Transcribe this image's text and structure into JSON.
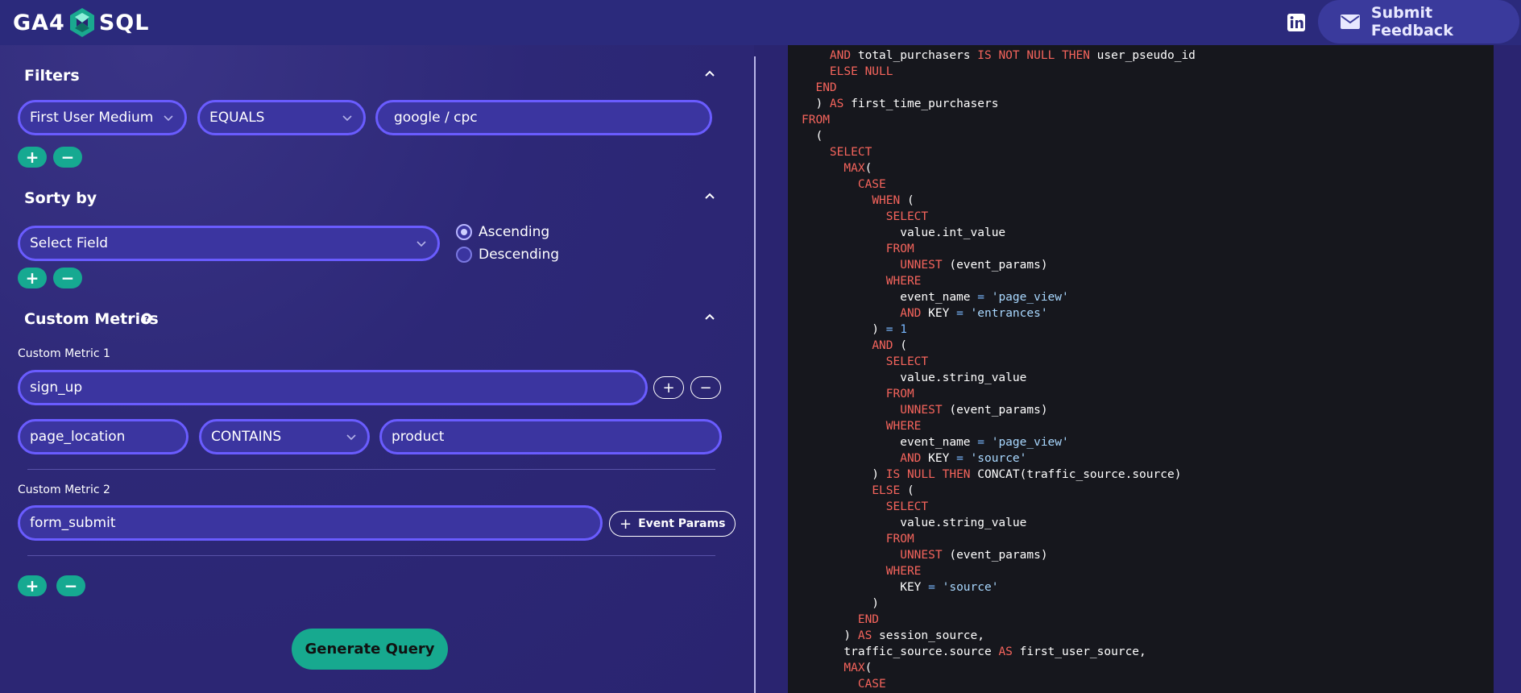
{
  "header": {
    "logo_left": "GA4",
    "logo_right": "SQL",
    "feedback_label": "Submit Feedback"
  },
  "filters": {
    "title": "Filters",
    "field": "First User Medium",
    "operator": "EQUALS",
    "value": "google / cpc",
    "add_label": "+",
    "remove_label": "−"
  },
  "sort": {
    "title": "Sorty by",
    "field_placeholder": "Select Field",
    "options": [
      "Ascending",
      "Descending"
    ],
    "selected": "Ascending",
    "add_label": "+",
    "remove_label": "−"
  },
  "custom_metrics": {
    "title": "Custom Metrics",
    "metric1": {
      "label": "Custom Metric 1",
      "event": "sign_up",
      "param": "page_location",
      "operator": "CONTAINS",
      "value": "product",
      "add_label": "+",
      "remove_label": "−"
    },
    "metric2": {
      "label": "Custom Metric 2",
      "event": "form_submit",
      "event_params_label": "Event Params"
    },
    "add_label": "+",
    "remove_label": "−"
  },
  "generate_label": "Generate Query",
  "sql_lines": [
    [
      [
        "    "
      ],
      [
        "AND",
        "kw"
      ],
      [
        " total_purchasers "
      ],
      [
        "IS NOT NULL THEN",
        "kw"
      ],
      [
        " user_pseudo_id"
      ]
    ],
    [
      [
        "    "
      ],
      [
        "ELSE NULL",
        "kw"
      ]
    ],
    [
      [
        "  "
      ],
      [
        "END",
        "kw"
      ]
    ],
    [
      [
        "  ) "
      ],
      [
        "AS",
        "kw"
      ],
      [
        " first_time_purchasers"
      ]
    ],
    [
      [
        "FROM",
        "kw"
      ]
    ],
    [
      [
        "  ("
      ]
    ],
    [
      [
        "    "
      ],
      [
        "SELECT",
        "kw"
      ]
    ],
    [
      [
        "      "
      ],
      [
        "MAX",
        "kw"
      ],
      [
        "("
      ]
    ],
    [
      [
        "        "
      ],
      [
        "CASE",
        "kw"
      ]
    ],
    [
      [
        "          "
      ],
      [
        "WHEN",
        "kw"
      ],
      [
        " ("
      ]
    ],
    [
      [
        "            "
      ],
      [
        "SELECT",
        "kw"
      ]
    ],
    [
      [
        "              value.int_value"
      ]
    ],
    [
      [
        "            "
      ],
      [
        "FROM",
        "kw"
      ]
    ],
    [
      [
        "              "
      ],
      [
        "UNNEST",
        "kw"
      ],
      [
        " (event_params)"
      ]
    ],
    [
      [
        "            "
      ],
      [
        "WHERE",
        "kw"
      ]
    ],
    [
      [
        "              event_name "
      ],
      [
        "=",
        "num"
      ],
      [
        " "
      ],
      [
        "'page_view'",
        "str"
      ]
    ],
    [
      [
        "              "
      ],
      [
        "AND",
        "kw"
      ],
      [
        " KEY "
      ],
      [
        "=",
        "num"
      ],
      [
        " "
      ],
      [
        "'entrances'",
        "str"
      ]
    ],
    [
      [
        "          ) "
      ],
      [
        "= 1",
        "num"
      ]
    ],
    [
      [
        "          "
      ],
      [
        "AND",
        "kw"
      ],
      [
        " ("
      ]
    ],
    [
      [
        "            "
      ],
      [
        "SELECT",
        "kw"
      ]
    ],
    [
      [
        "              value.string_value"
      ]
    ],
    [
      [
        "            "
      ],
      [
        "FROM",
        "kw"
      ]
    ],
    [
      [
        "              "
      ],
      [
        "UNNEST",
        "kw"
      ],
      [
        " (event_params)"
      ]
    ],
    [
      [
        "            "
      ],
      [
        "WHERE",
        "kw"
      ]
    ],
    [
      [
        "              event_name "
      ],
      [
        "=",
        "num"
      ],
      [
        " "
      ],
      [
        "'page_view'",
        "str"
      ]
    ],
    [
      [
        "              "
      ],
      [
        "AND",
        "kw"
      ],
      [
        " KEY "
      ],
      [
        "=",
        "num"
      ],
      [
        " "
      ],
      [
        "'source'",
        "str"
      ]
    ],
    [
      [
        "          ) "
      ],
      [
        "IS NULL THEN",
        "kw"
      ],
      [
        " CONCAT(traffic_source.source)"
      ]
    ],
    [
      [
        "          "
      ],
      [
        "ELSE",
        "kw"
      ],
      [
        " ("
      ]
    ],
    [
      [
        "            "
      ],
      [
        "SELECT",
        "kw"
      ]
    ],
    [
      [
        "              value.string_value"
      ]
    ],
    [
      [
        "            "
      ],
      [
        "FROM",
        "kw"
      ]
    ],
    [
      [
        "              "
      ],
      [
        "UNNEST",
        "kw"
      ],
      [
        " (event_params)"
      ]
    ],
    [
      [
        "            "
      ],
      [
        "WHERE",
        "kw"
      ]
    ],
    [
      [
        "              KEY "
      ],
      [
        "=",
        "num"
      ],
      [
        " "
      ],
      [
        "'source'",
        "str"
      ]
    ],
    [
      [
        "          )"
      ]
    ],
    [
      [
        "        "
      ],
      [
        "END",
        "kw"
      ]
    ],
    [
      [
        "      ) "
      ],
      [
        "AS",
        "kw"
      ],
      [
        " session_source,"
      ]
    ],
    [
      [
        "      traffic_source.source "
      ],
      [
        "AS",
        "kw"
      ],
      [
        " first_user_source,"
      ]
    ],
    [
      [
        "      "
      ],
      [
        "MAX",
        "kw"
      ],
      [
        "("
      ]
    ],
    [
      [
        "        "
      ],
      [
        "CASE",
        "kw"
      ]
    ]
  ]
}
